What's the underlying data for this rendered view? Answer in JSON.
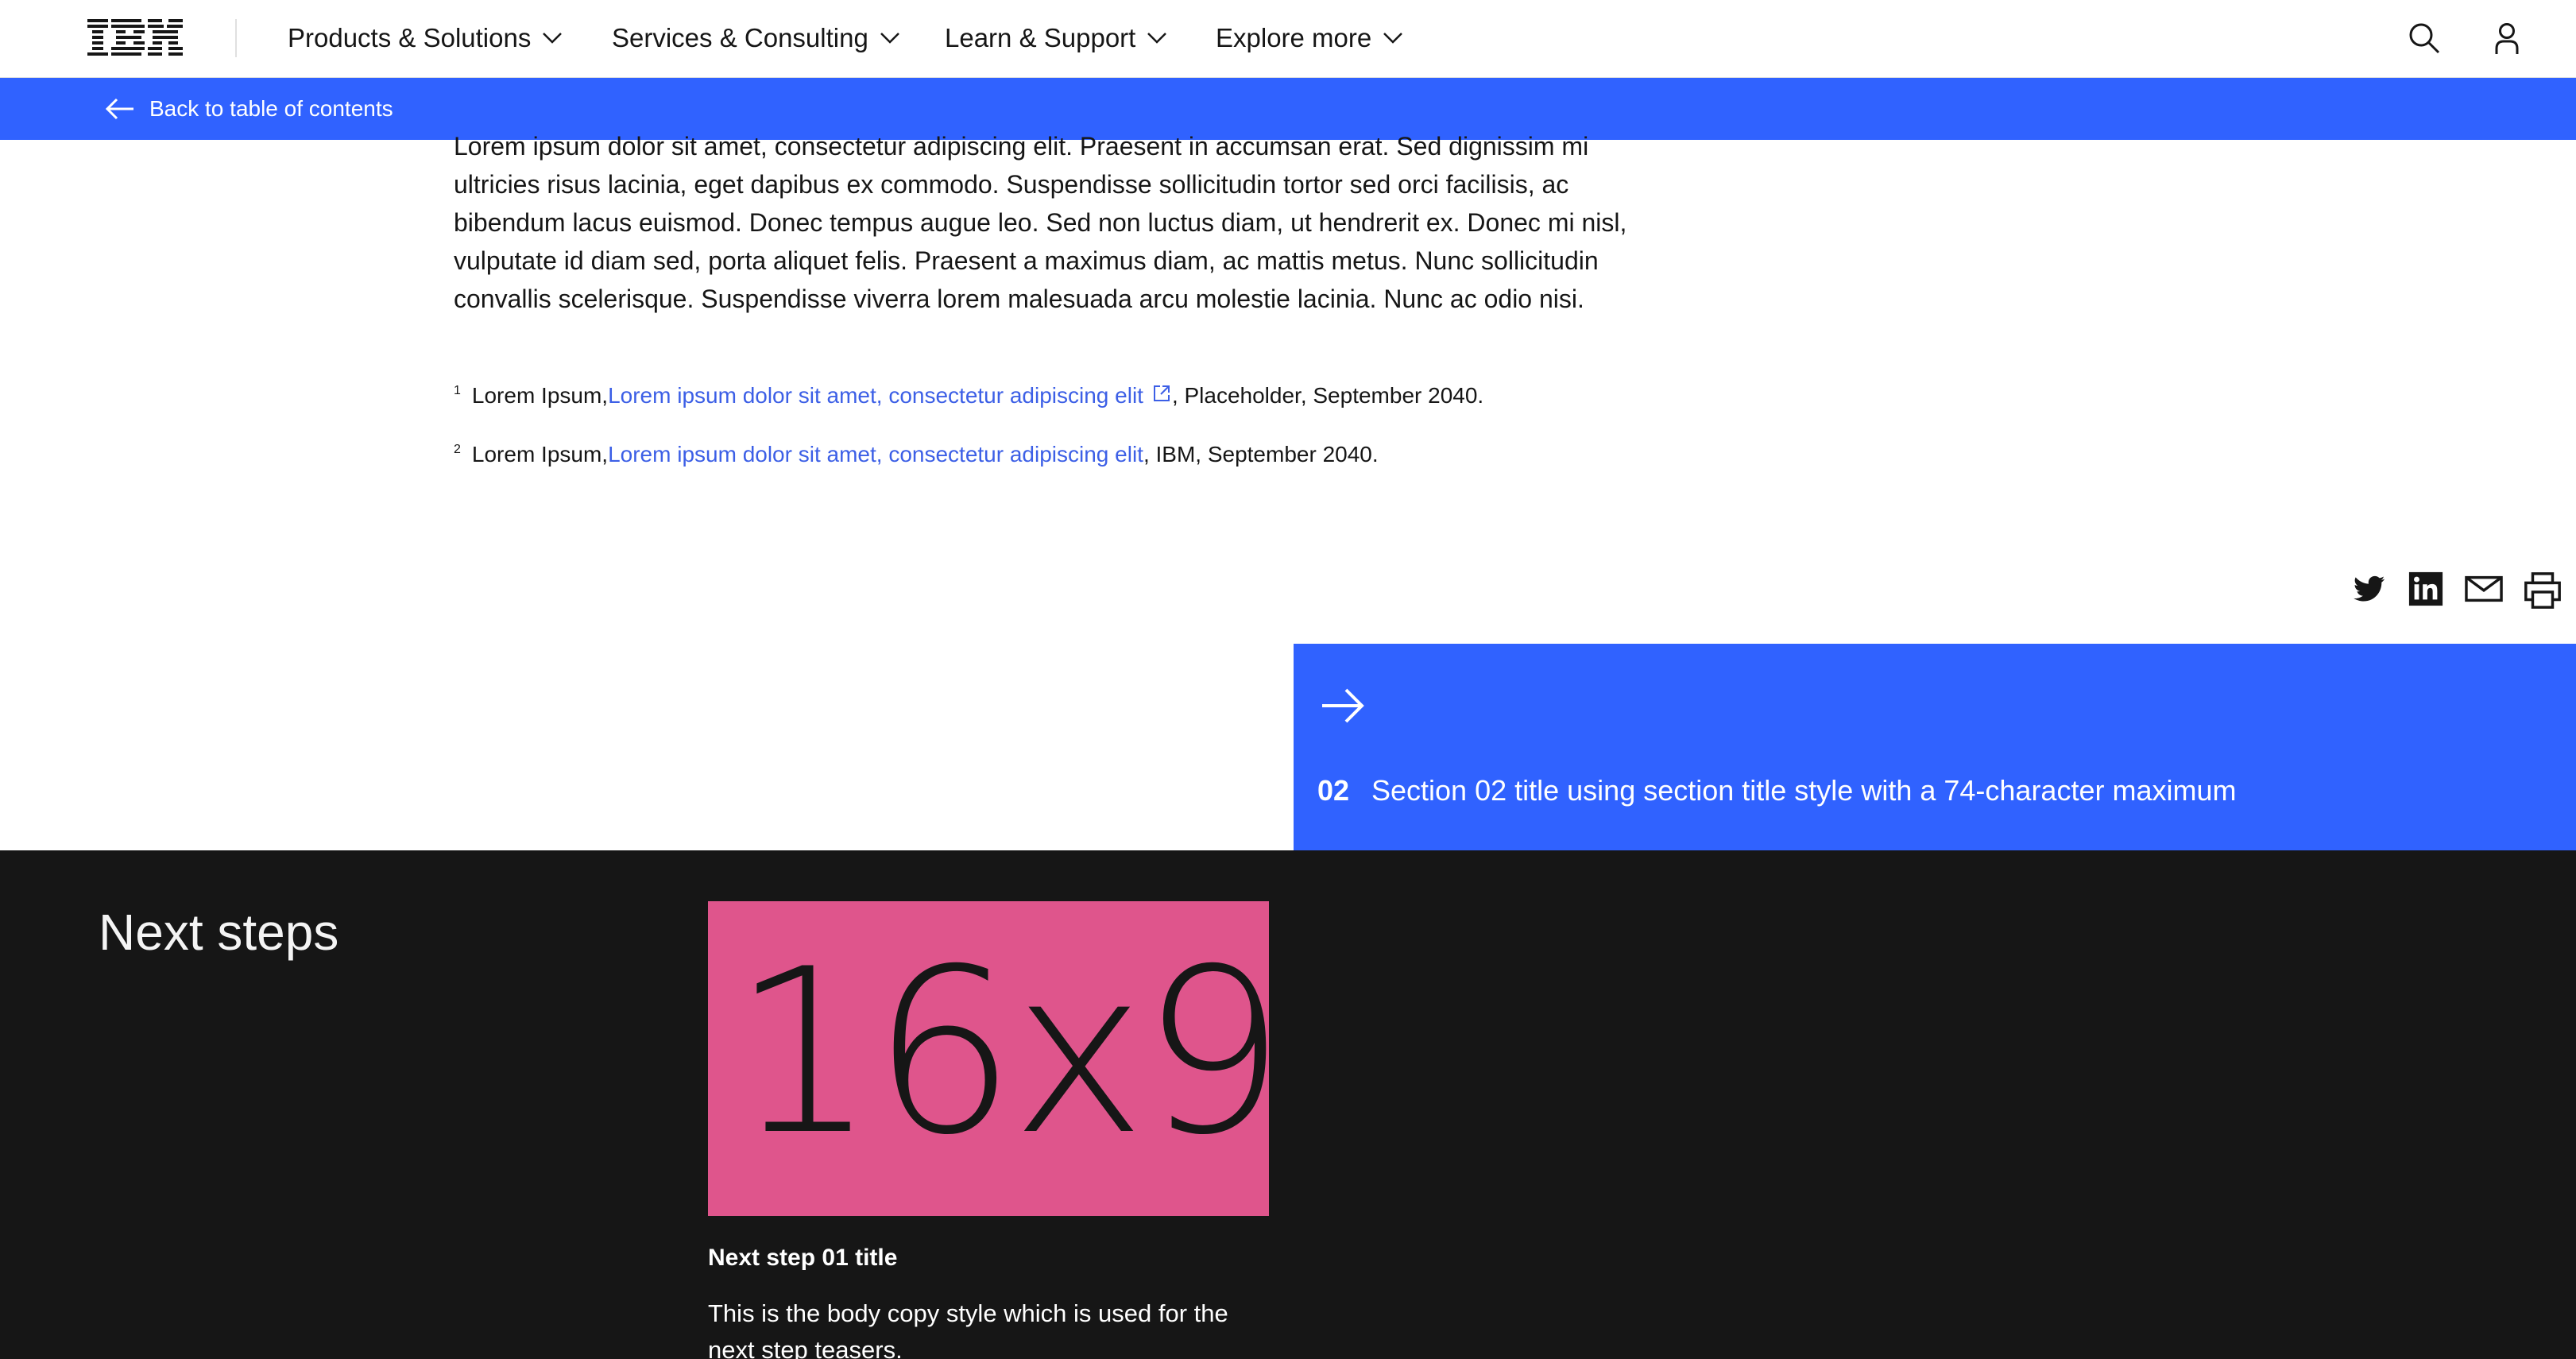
{
  "masthead": {
    "logo_text": "IBM",
    "nav": [
      {
        "label": "Products & Solutions"
      },
      {
        "label": "Services & Consulting"
      },
      {
        "label": "Learn & Support"
      },
      {
        "label": "Explore more"
      }
    ],
    "icons": [
      "search-icon",
      "user-icon"
    ]
  },
  "back_bar": {
    "label": "Back to table of contents",
    "icon": "arrow-left-icon"
  },
  "article": {
    "paragraph": "Lorem ipsum dolor sit amet, consectetur adipiscing elit. Praesent in accumsan erat. Sed dignissim mi ultricies risus lacinia, eget dapibus ex commodo. Suspendisse sollicitudin tortor sed orci facilisis, ac bibendum lacus euismod. Donec tempus augue leo. Sed non luctus diam, ut hendrerit ex. Donec mi nisl, vulputate id diam sed, porta aliquet felis. Praesent a maximus diam, ac mattis metus. Nunc sollicitudin convallis scelerisque. Suspendisse viverra lorem malesuada arcu molestie lacinia. Nunc ac odio nisi.",
    "footnotes": [
      {
        "num": "1",
        "prefix": "Lorem Ipsum, ",
        "link": "Lorem ipsum dolor sit amet, consectetur adipiscing elit",
        "suffix": ", Placeholder, September 2040.",
        "external": true
      },
      {
        "num": "2",
        "prefix": "Lorem Ipsum, ",
        "link": "Lorem ipsum dolor sit amet, consectetur adipiscing elit",
        "suffix": ", IBM, September 2040.",
        "external": false
      }
    ]
  },
  "share": [
    "twitter-icon",
    "linkedin-icon",
    "email-icon",
    "print-icon"
  ],
  "next_section": {
    "number": "02",
    "title": "Section 02 title using section title style with a 74-character maximum"
  },
  "next_steps": {
    "heading": "Next steps",
    "items": [
      {
        "image_label": "16x9",
        "title": "Next step 01 title",
        "body": "This is the body copy style which is used for the next step teasers."
      }
    ]
  },
  "colors": {
    "accent": "#3062ff",
    "link": "#3c5fe6",
    "dark_bg": "#161616",
    "teaser_bg": "#df558c"
  }
}
